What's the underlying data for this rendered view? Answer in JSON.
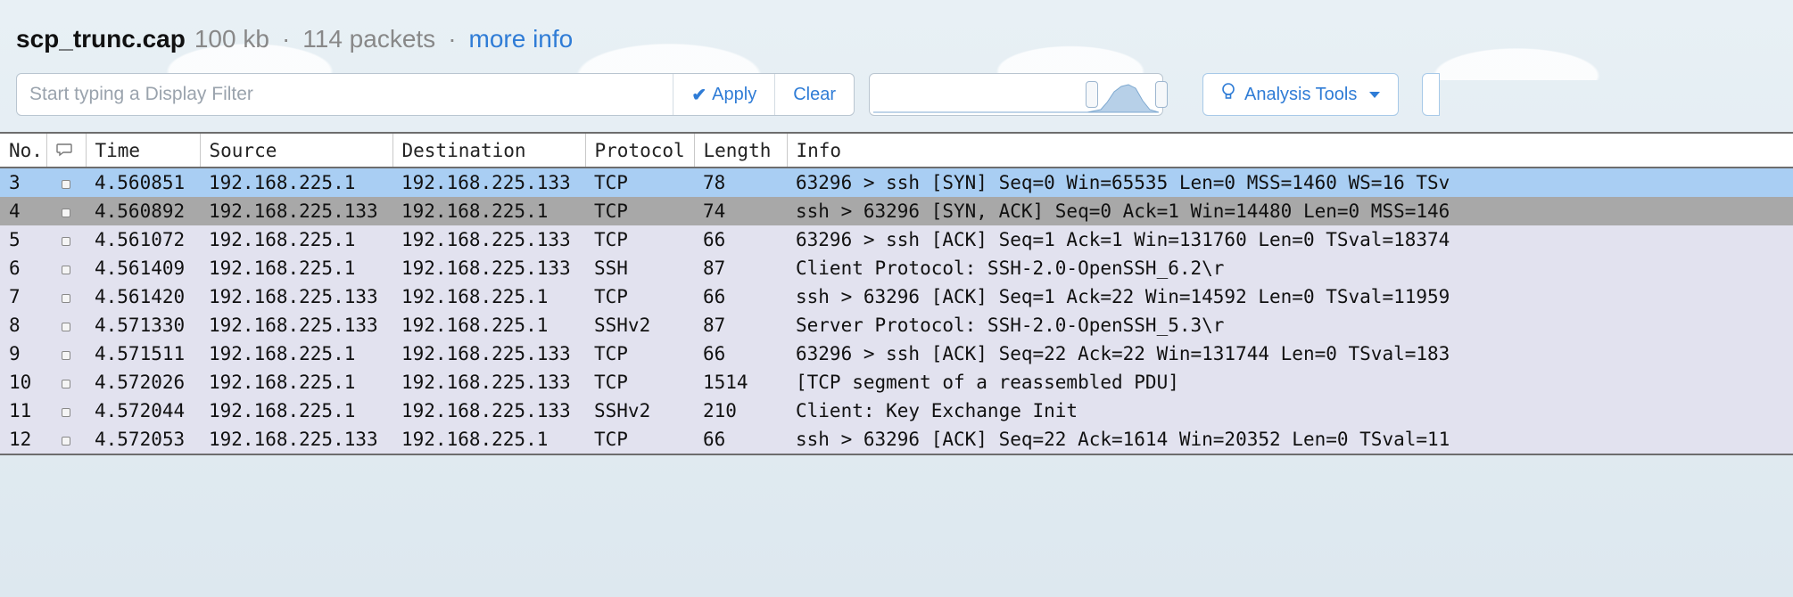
{
  "header": {
    "filename": "scp_trunc.cap",
    "size": "100 kb",
    "packets": "114 packets",
    "more_info": "more info"
  },
  "toolbar": {
    "filter_placeholder": "Start typing a Display Filter",
    "apply_label": "Apply",
    "clear_label": "Clear",
    "analysis_label": "Analysis Tools"
  },
  "columns": {
    "no": "No.",
    "time": "Time",
    "source": "Source",
    "destination": "Destination",
    "protocol": "Protocol",
    "length": "Length",
    "info": "Info"
  },
  "rows": [
    {
      "no": "3",
      "time": "4.560851",
      "src": "192.168.225.1",
      "dst": "192.168.225.133",
      "proto": "TCP",
      "len": "78",
      "info": "63296 > ssh [SYN] Seq=0 Win=65535 Len=0 MSS=1460 WS=16 TSv",
      "cls": "sel-light"
    },
    {
      "no": "4",
      "time": "4.560892",
      "src": "192.168.225.133",
      "dst": "192.168.225.1",
      "proto": "TCP",
      "len": "74",
      "info": "ssh > 63296 [SYN, ACK] Seq=0 Ack=1 Win=14480 Len=0 MSS=146",
      "cls": "sel-dark"
    },
    {
      "no": "5",
      "time": "4.561072",
      "src": "192.168.225.1",
      "dst": "192.168.225.133",
      "proto": "TCP",
      "len": "66",
      "info": "63296 > ssh [ACK] Seq=1 Ack=1 Win=131760 Len=0 TSval=18374",
      "cls": ""
    },
    {
      "no": "6",
      "time": "4.561409",
      "src": "192.168.225.1",
      "dst": "192.168.225.133",
      "proto": "SSH",
      "len": "87",
      "info": "Client Protocol: SSH-2.0-OpenSSH_6.2\\r",
      "cls": ""
    },
    {
      "no": "7",
      "time": "4.561420",
      "src": "192.168.225.133",
      "dst": "192.168.225.1",
      "proto": "TCP",
      "len": "66",
      "info": "ssh > 63296 [ACK] Seq=1 Ack=22 Win=14592 Len=0 TSval=11959",
      "cls": ""
    },
    {
      "no": "8",
      "time": "4.571330",
      "src": "192.168.225.133",
      "dst": "192.168.225.1",
      "proto": "SSHv2",
      "len": "87",
      "info": "Server Protocol: SSH-2.0-OpenSSH_5.3\\r",
      "cls": ""
    },
    {
      "no": "9",
      "time": "4.571511",
      "src": "192.168.225.1",
      "dst": "192.168.225.133",
      "proto": "TCP",
      "len": "66",
      "info": "63296 > ssh [ACK] Seq=22 Ack=22 Win=131744 Len=0 TSval=183",
      "cls": ""
    },
    {
      "no": "10",
      "time": "4.572026",
      "src": "192.168.225.1",
      "dst": "192.168.225.133",
      "proto": "TCP",
      "len": "1514",
      "info": "[TCP segment of a reassembled PDU]",
      "cls": ""
    },
    {
      "no": "11",
      "time": "4.572044",
      "src": "192.168.225.1",
      "dst": "192.168.225.133",
      "proto": "SSHv2",
      "len": "210",
      "info": "Client: Key Exchange Init",
      "cls": ""
    },
    {
      "no": "12",
      "time": "4.572053",
      "src": "192.168.225.133",
      "dst": "192.168.225.1",
      "proto": "TCP",
      "len": "66",
      "info": "ssh > 63296 [ACK] Seq=22 Ack=1614 Win=20352 Len=0 TSval=11",
      "cls": ""
    }
  ]
}
